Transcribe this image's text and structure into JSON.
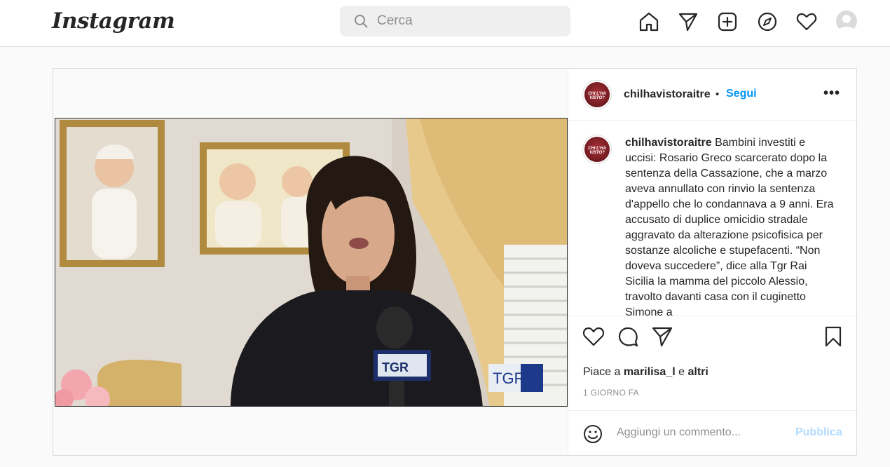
{
  "header": {
    "logo": "Instagram",
    "search_placeholder": "Cerca",
    "nav_icons": [
      "home-icon",
      "direct-icon",
      "new-post-icon",
      "explore-icon",
      "activity-icon",
      "profile-avatar"
    ]
  },
  "post": {
    "author": "chilhavistoraitre",
    "author_avatar_text": "CHI L'HA VISTO?",
    "follow_label": "Segui",
    "separator": "•",
    "more_label": "•••",
    "caption_author": "chilhavistoraitre",
    "caption_text": "Bambini investiti e uccisi: Rosario Greco scarcerato dopo la sentenza della Cassazione, che a marzo aveva annullato con rinvio la sentenza d'appello che lo condannava a 9 anni. Era accusato di duplice omicidio stradale aggravato da alterazione psicofisica per sostanze alcoliche e stupefacenti. “Non doveva succedere”, dice alla Tgr Rai Sicilia la mamma del piccolo Alessio, travolto davanti casa con il cuginetto Simone a",
    "video_logo": "TGR",
    "mic_logo": "TGR",
    "likes_prefix": "Piace a",
    "likes_user": "marilisa_l",
    "likes_connector": "e",
    "likes_others": "altri",
    "timestamp": "1 GIORNO FA",
    "comment_placeholder": "Aggiungi un commento...",
    "publish_label": "Pubblica"
  },
  "colors": {
    "accent": "#0095f6",
    "publish_disabled": "#b3dbff",
    "border": "#dbdbdb",
    "background": "#fafafa"
  }
}
